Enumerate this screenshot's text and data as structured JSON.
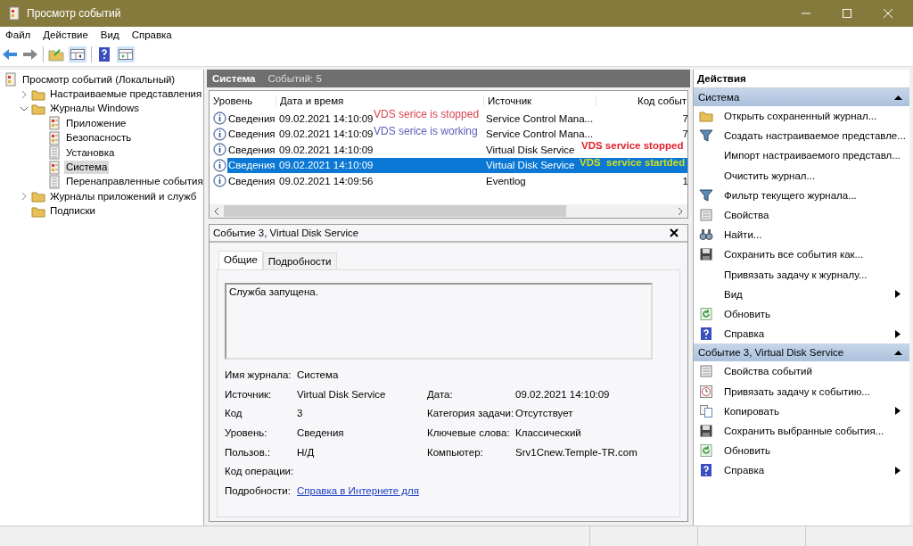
{
  "window": {
    "title": "Просмотр событий"
  },
  "menu": [
    "Файл",
    "Действие",
    "Вид",
    "Справка"
  ],
  "tree": [
    {
      "label": "Просмотр событий (Локальный)",
      "kind": "viewer",
      "selected": false,
      "children": [
        {
          "label": "Настраиваемые представления",
          "kind": "folder",
          "expanded": false,
          "selected": false
        },
        {
          "label": "Журналы Windows",
          "kind": "folder",
          "expanded": true,
          "selected": false,
          "children": [
            {
              "label": "Приложение",
              "kind": "log",
              "selected": false
            },
            {
              "label": "Безопасность",
              "kind": "log",
              "selected": false
            },
            {
              "label": "Установка",
              "kind": "plain",
              "selected": false
            },
            {
              "label": "Система",
              "kind": "log",
              "selected": true
            },
            {
              "label": "Перенаправленные события",
              "kind": "plain",
              "selected": false
            }
          ]
        },
        {
          "label": "Журналы приложений и служб",
          "kind": "folder",
          "expanded": false,
          "selected": false
        },
        {
          "label": "Подписки",
          "kind": "folder",
          "selected": false
        }
      ]
    }
  ],
  "log": {
    "title": "Система",
    "count": "Событий: 5"
  },
  "events": {
    "columns": [
      "Уровень",
      "Дата и время",
      "Источник",
      "Код событ"
    ],
    "rows": [
      {
        "level": "Сведения",
        "datetime": "09.02.2021 14:10:09",
        "source": "Service Control Mana...",
        "code": "7",
        "selected": false
      },
      {
        "level": "Сведения",
        "datetime": "09.02.2021 14:10:09",
        "source": "Service Control Mana...",
        "code": "7",
        "selected": false
      },
      {
        "level": "Сведения",
        "datetime": "09.02.2021 14:10:09",
        "source": "Virtual Disk Service",
        "selected": false
      },
      {
        "level": "Сведения",
        "datetime": "09.02.2021 14:10:09",
        "source": "Virtual Disk Service",
        "selected": true
      },
      {
        "level": "Сведения",
        "datetime": "09.02.2021 14:09:56",
        "source": "Eventlog",
        "code": "1",
        "selected": false
      }
    ]
  },
  "annotations": [
    {
      "text": "VDS serice is stopped",
      "color": "#d8434c",
      "kind": "plain"
    },
    {
      "text": "VDS serice is working",
      "color": "#5c5cb8",
      "kind": "plain"
    },
    {
      "text": "VDS service stopped",
      "color": "#e0202a",
      "kind": "bold"
    },
    {
      "text": "VDS  service startded",
      "color": "#d2df1e",
      "kind": "bold"
    }
  ],
  "details": {
    "title": "Событие 3, Virtual Disk Service",
    "tabs": [
      {
        "label": "Общие",
        "selected": true
      },
      {
        "label": "Подробности",
        "selected": false
      }
    ],
    "message": "Служба запущена.",
    "fields": [
      {
        "label": "Имя журнала:",
        "value": "Система"
      },
      {
        "label": "Источник:",
        "value": "Virtual Disk Service",
        "label2": "Дата:",
        "value2": "09.02.2021 14:10:09"
      },
      {
        "label": "Код",
        "value": "3",
        "label2": "Категория задачи:",
        "value2": "Отсутствует"
      },
      {
        "label": "Уровень:",
        "value": "Сведения",
        "label2": "Ключевые слова:",
        "value2": "Классический"
      },
      {
        "label": "Пользов.:",
        "value": "Н/Д",
        "label2": "Компьютер:",
        "value2": "Srv1Cnew.Temple-TR.com"
      },
      {
        "label": "Код операции:"
      },
      {
        "label": "Подробности:",
        "link": "Справка в Интернете для "
      }
    ]
  },
  "actions": {
    "title": "Действия",
    "sections": [
      {
        "title": "Система",
        "expanded": true,
        "items": [
          {
            "label": "Открыть сохраненный журнал...",
            "kind": "folder"
          },
          {
            "label": "Создать настраиваемое представле...",
            "kind": "funnel"
          },
          {
            "label": "Импорт настраиваемого представл...",
            "kind": "none"
          },
          {
            "label": "Очистить журнал...",
            "kind": "none"
          },
          {
            "label": "Фильтр текущего журнала...",
            "kind": "funnel"
          },
          {
            "label": "Свойства",
            "kind": "props"
          },
          {
            "label": "Найти...",
            "kind": "find"
          },
          {
            "label": "Сохранить все события как...",
            "kind": "save"
          },
          {
            "label": "Привязать задачу к журналу...",
            "kind": "none"
          },
          {
            "label": "Вид",
            "kind": "none",
            "submenu": true
          },
          {
            "label": "Обновить",
            "kind": "refresh"
          },
          {
            "label": "Справка",
            "kind": "help",
            "submenu": true
          }
        ]
      },
      {
        "title": "Событие 3, Virtual Disk Service",
        "expanded": true,
        "items": [
          {
            "label": "Свойства событий",
            "kind": "props"
          },
          {
            "label": "Привязать задачу к событию...",
            "kind": "task"
          },
          {
            "label": "Копировать",
            "kind": "copy",
            "submenu": true
          },
          {
            "label": "Сохранить выбранные события...",
            "kind": "save"
          },
          {
            "label": "Обновить",
            "kind": "refresh"
          },
          {
            "label": "Справка",
            "kind": "help",
            "submenu": true
          }
        ]
      }
    ]
  }
}
